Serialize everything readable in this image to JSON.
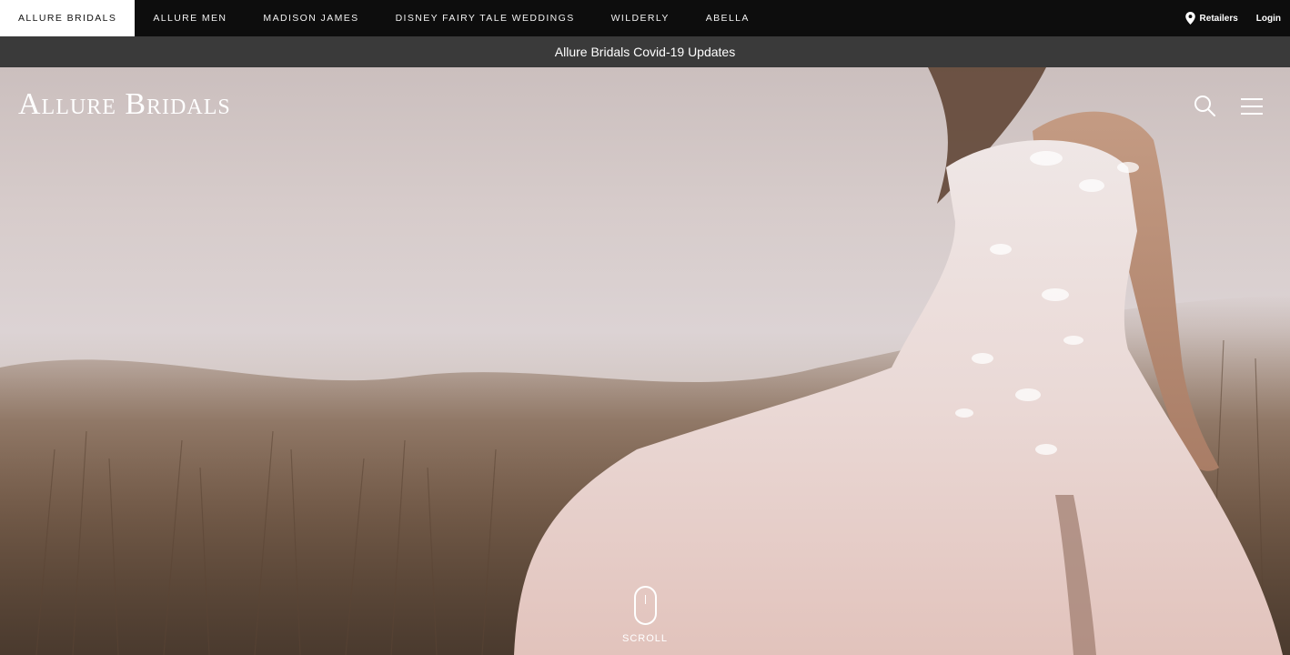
{
  "brand_nav": {
    "items": [
      {
        "label": "ALLURE BRIDALS",
        "active": true
      },
      {
        "label": "ALLURE MEN",
        "active": false
      },
      {
        "label": "MADISON JAMES",
        "active": false
      },
      {
        "label": "DISNEY FAIRY TALE WEDDINGS",
        "active": false
      },
      {
        "label": "WILDERLY",
        "active": false
      },
      {
        "label": "ABELLA",
        "active": false
      }
    ],
    "retailers_label": "Retailers",
    "retailers_icon": "location-pin-icon",
    "login_label": "Login"
  },
  "notice": {
    "text": "Allure Bridals Covid-19 Updates"
  },
  "header": {
    "logo": "Allure Bridals",
    "search_icon": "search-icon",
    "menu_icon": "hamburger-menu-icon"
  },
  "hero": {
    "scroll_label": "SCROLL",
    "scroll_icon": "mouse-scroll-icon"
  },
  "colors": {
    "topbar": "#0d0d0d",
    "notice_bar": "#3a3a3a",
    "active_tab": "#ffffff"
  }
}
